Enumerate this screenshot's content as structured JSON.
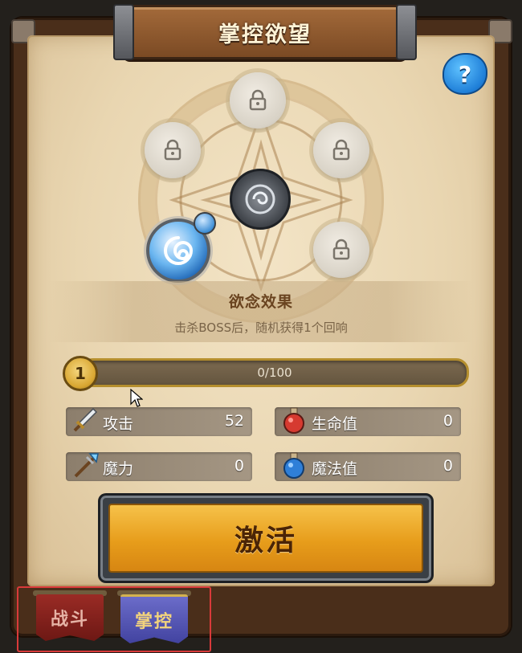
{
  "panel": {
    "title": "掌控欲望",
    "help_label": "?"
  },
  "effect": {
    "title": "欲念效果",
    "description": "击杀BOSS后，随机获得1个回响"
  },
  "progress": {
    "level": "1",
    "text": "0/100",
    "fraction": 0
  },
  "stats": [
    {
      "label": "攻击",
      "value": "52",
      "icon": "sword-icon"
    },
    {
      "label": "生命值",
      "value": "0",
      "icon": "red-potion-icon"
    },
    {
      "label": "魔力",
      "value": "0",
      "icon": "magic-spear-icon"
    },
    {
      "label": "魔法值",
      "value": "0",
      "icon": "blue-potion-icon"
    }
  ],
  "activate_label": "激活",
  "tabs": [
    {
      "label": "战斗",
      "active": false
    },
    {
      "label": "掌控",
      "active": true
    }
  ],
  "colors": {
    "accent_gold": "#e79d1b",
    "highlight_red": "#d93a3a"
  }
}
